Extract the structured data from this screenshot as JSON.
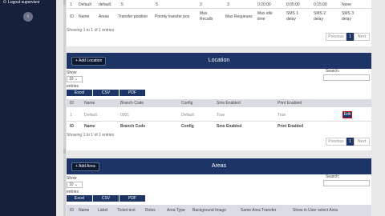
{
  "sidebar": {
    "logout_label": "Logout supervisor"
  },
  "queue": {
    "row": [
      "1",
      "Default",
      "default.",
      "5",
      "5",
      "3",
      "3",
      "0:20:00",
      "0:05:00",
      "0:15:00",
      "None"
    ],
    "headers": [
      "ID",
      "Name",
      "Areas",
      "Transfer position",
      "Priority transfer pos",
      "Max Recalls",
      "Max Requeues",
      "Max idle time",
      "SMS 1 delay",
      "SMS 2 delay",
      "SMS 3 delay"
    ],
    "header_lines": [
      [
        "Max",
        "Recalls"
      ],
      [
        "Max idle",
        "time"
      ],
      [
        "SMS 1",
        "delay"
      ],
      [
        "SMS 2",
        "delay"
      ],
      [
        "SMS 3",
        "delay"
      ]
    ],
    "showing": "Showing 1 to 1 of 1 entries",
    "pagination": {
      "prev": "Previous",
      "page": "1",
      "next": "Next"
    }
  },
  "location": {
    "title": "Location",
    "add_label": "+ Add Location",
    "show": "Show",
    "entries_value": "10",
    "entries": "entries",
    "search_label": "Search:",
    "export": [
      "Excel",
      "CSV",
      "PDF"
    ],
    "headers": [
      "ID",
      "Name",
      "Branch Code",
      "Config",
      "Sms Enabled",
      "Print Enabled"
    ],
    "row": [
      "1",
      "Default",
      "0001",
      "Default",
      "True",
      "True"
    ],
    "edit_label": "Edit",
    "showing": "Showing 1 to 1 of 1 entries",
    "pagination": {
      "prev": "Previous",
      "page": "1",
      "next": "Next"
    }
  },
  "areas": {
    "title": "Areas",
    "add_label": "+ Add Area",
    "show": "Show",
    "entries_value": "10",
    "entries": "entries",
    "search_label": "Search:",
    "export": [
      "Excel",
      "CSV",
      "PDF"
    ],
    "headers": [
      "ID",
      "Name",
      "Label",
      "Ticket text",
      "Roles",
      "Area Type",
      "Background Image",
      "Same Area Transfer",
      "Show in User select Area"
    ]
  }
}
